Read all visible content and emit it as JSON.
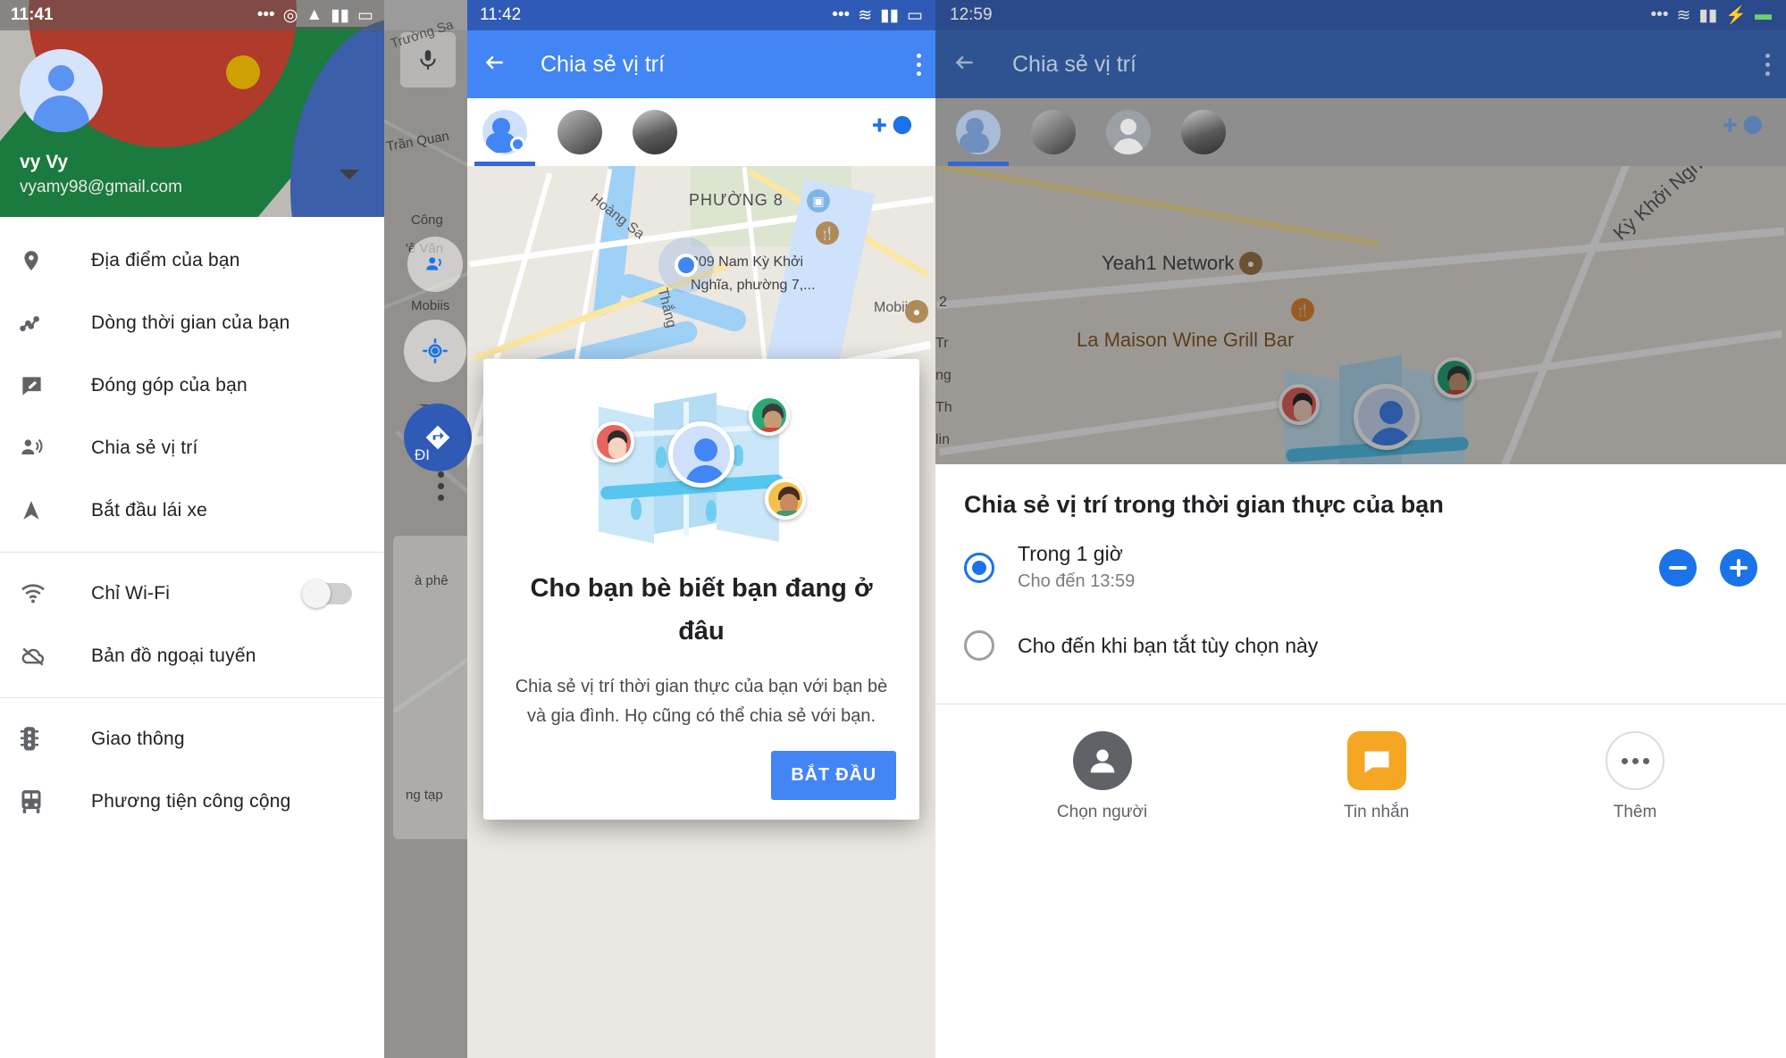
{
  "panels": {
    "drawer": {
      "status": {
        "clock": "11:41"
      },
      "account": {
        "name": "vy Vy",
        "email": "vyamy98@gmail.com",
        "expand_icon": "chevron-down-icon",
        "avatar_icon": "account-avatar-icon"
      },
      "menu_groups": [
        {
          "items": [
            {
              "label": "Địa điểm của bạn",
              "icon": "place-pin-icon"
            },
            {
              "label": "Dòng thời gian của bạn",
              "icon": "timeline-icon"
            },
            {
              "label": "Đóng góp của bạn",
              "icon": "edit-contribution-icon"
            },
            {
              "label": "Chia sẻ vị trí",
              "icon": "share-location-icon"
            },
            {
              "label": "Bắt đầu lái xe",
              "icon": "navigation-arrow-icon"
            }
          ]
        },
        {
          "items": [
            {
              "label": "Chỉ Wi-Fi",
              "icon": "wifi-icon",
              "toggle": "off"
            },
            {
              "label": "Bản đồ ngoại tuyến",
              "icon": "cloud-off-icon"
            }
          ]
        },
        {
          "items": [
            {
              "label": "Giao thông",
              "icon": "traffic-light-icon"
            },
            {
              "label": "Phương tiện công cộng",
              "icon": "transit-train-icon"
            }
          ]
        }
      ]
    },
    "share": {
      "status": {
        "clock": "11:42"
      },
      "appbar": {
        "title": "Chia sẻ vị trí",
        "back_icon": "back-arrow-icon",
        "overflow_icon": "kebab-menu-icon"
      },
      "tabs": [
        {
          "name": "self-location-tab",
          "icon": "self-location-avatar-icon",
          "selected": true
        },
        {
          "name": "contact-tab-1",
          "icon": "contact-photo-icon",
          "selected": false
        },
        {
          "name": "contact-tab-2",
          "icon": "contact-photo-icon",
          "selected": false
        }
      ],
      "add_person_icon": "add-person-icon",
      "map": {
        "labels": [
          "PHƯỜNG 8",
          "Hoàng Sa",
          "Thắng",
          "Mobiis",
          "209 Nam Kỳ Khởi Nghĩa, phường 7,...",
          "Công",
          "ê Văn"
        ]
      },
      "dialog": {
        "illustration": "friends-on-map-illustration",
        "title": "Cho bạn bè biết bạn đang ở đâu",
        "body": "Chia sẻ vị trí thời gian thực của bạn với bạn bè và gia đình. Họ cũng có thể chia sẻ với bạn.",
        "button": "BẮT ĐẦU"
      }
    },
    "duration": {
      "status": {
        "clock": "12:59"
      },
      "appbar": {
        "title": "Chia sẻ vị trí",
        "back_icon": "back-arrow-icon",
        "overflow_icon": "kebab-menu-icon"
      },
      "tabs": [
        {
          "name": "self-location-tab",
          "icon": "self-location-avatar-icon",
          "selected": true
        },
        {
          "name": "contact-tab-1",
          "icon": "contact-photo-icon",
          "selected": false
        },
        {
          "name": "contact-tab-2",
          "icon": "contact-placeholder-icon",
          "selected": false
        },
        {
          "name": "contact-tab-3",
          "icon": "contact-photo-icon",
          "selected": false
        }
      ],
      "add_person_icon": "add-person-icon",
      "map": {
        "labels": [
          "Kỳ Khởi Nghĩa",
          "Yeah1 Network",
          "La Maison Wine Grill Bar",
          "Tr",
          "ng",
          "Th",
          "lin",
          "2"
        ]
      },
      "sheet": {
        "title": "Chia sẻ vị trí trong thời gian thực của bạn",
        "options": [
          {
            "label": "Trong 1 giờ",
            "sublabel": "Cho đến 13:59",
            "selected": true,
            "has_stepper": true,
            "minus_icon": "minus-circle-icon",
            "plus_icon": "plus-circle-icon"
          },
          {
            "label": "Cho đến khi bạn tắt tùy chọn này",
            "sublabel": "",
            "selected": false,
            "has_stepper": false
          }
        ],
        "actions": [
          {
            "label": "Chọn người",
            "icon": "person-circle-icon"
          },
          {
            "label": "Tin nhắn",
            "icon": "messages-app-icon"
          },
          {
            "label": "Thêm",
            "icon": "more-horizontal-icon"
          }
        ]
      }
    }
  },
  "colors": {
    "accent_blue": "#4285f4",
    "appbar_blue": "#4285f4",
    "dim_blue": "#2f5391",
    "radio_blue": "#1a73e8",
    "msg_orange": "#f5a623"
  }
}
